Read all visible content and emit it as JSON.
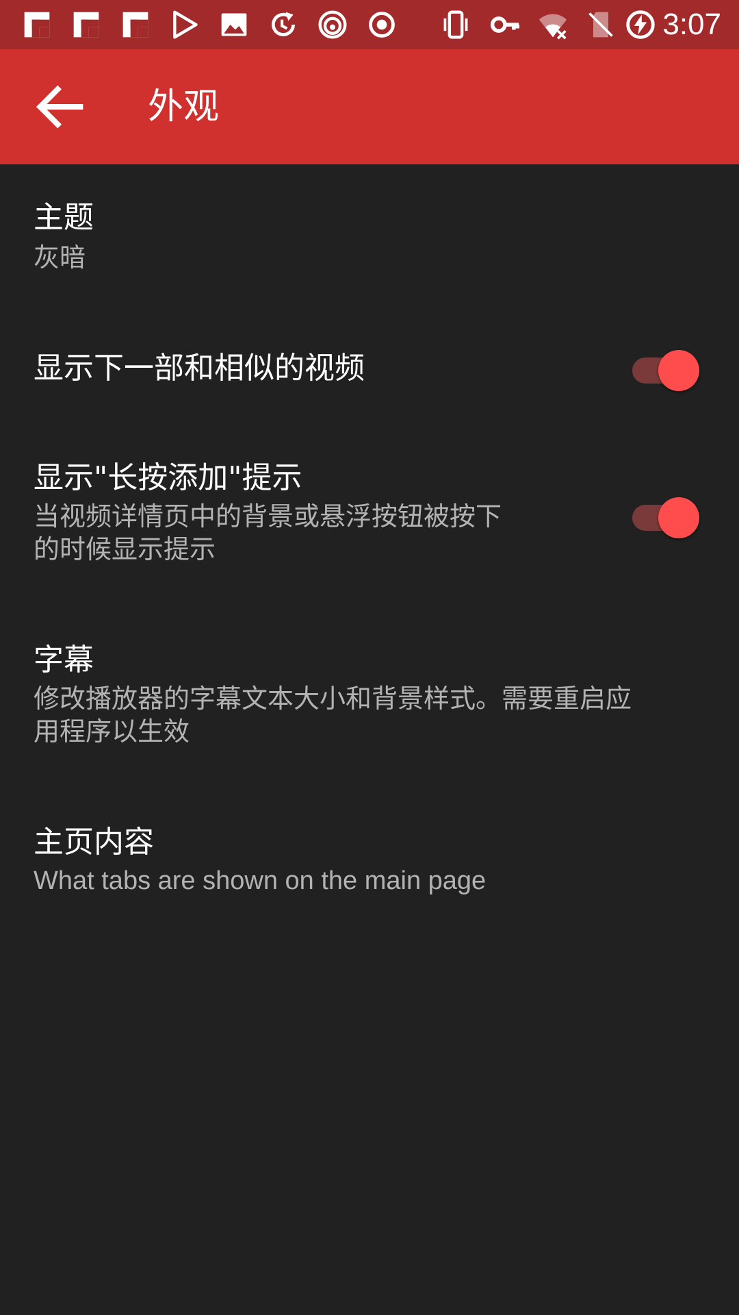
{
  "status_bar": {
    "time": "3:07",
    "left_icons": [
      "flipboard-icon",
      "flipboard-icon",
      "flipboard-icon",
      "play-store-icon",
      "image-icon",
      "sync-icon",
      "podcast-icon",
      "record-icon"
    ],
    "right_icons": [
      "vibrate-icon",
      "vpn-key-icon",
      "wifi-off-icon",
      "no-sim-icon",
      "battery-charging-icon"
    ]
  },
  "app_bar": {
    "title": "外观",
    "back_icon": "arrow-back-icon"
  },
  "preferences": [
    {
      "title": "主题",
      "summary": "灰暗"
    },
    {
      "title": "显示下一部和相似的视频",
      "switch_on": true
    },
    {
      "title": "显示\"长按添加\"提示",
      "summary_line1": "当视频详情页中的背景或悬浮按钮被按下",
      "summary_line2": "的时候显示提示",
      "switch_on": true
    },
    {
      "title": "字幕",
      "summary_line1": "修改播放器的字幕文本大小和背景样式。需要重启应",
      "summary_line2": "用程序以生效"
    },
    {
      "title": "主页内容",
      "summary": "What tabs are shown on the main page"
    }
  ],
  "colors": {
    "status_bar": "#a32a2a",
    "app_bar": "#d0312f",
    "background": "#212121",
    "accent": "#ff4d4d",
    "switch_track": "#7a3a3a"
  }
}
